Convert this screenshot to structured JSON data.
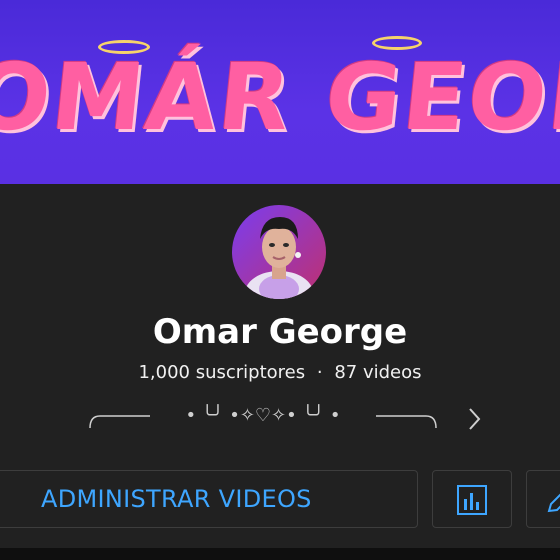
{
  "banner": {
    "text": "OMÁR GEORGE",
    "color_bg": "#5130e0",
    "color_text": "#ff5fa2",
    "color_halo": "#f6d36b"
  },
  "channel": {
    "name": "Omar George",
    "subscribers": "1,000 suscriptores",
    "separator": "·",
    "videos": "87 videos",
    "decorative_line": "• ╰╯ •✧♡✧• ╰╯ •"
  },
  "actions": {
    "manage_videos_label": "ADMINISTRAR VIDEOS",
    "stats_icon": "bar-chart-icon",
    "edit_icon": "pencil-icon",
    "more_icon": "chevron-right-icon"
  },
  "colors": {
    "background": "#212121",
    "accent": "#3ea6ff"
  }
}
